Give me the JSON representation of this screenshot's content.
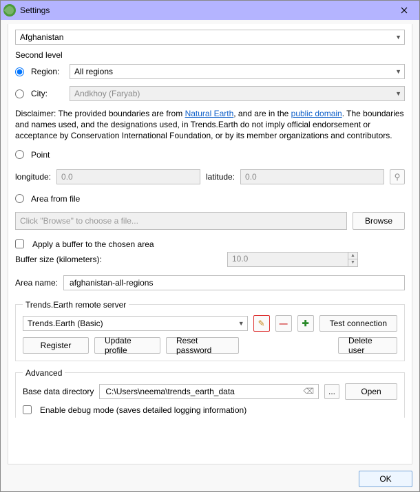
{
  "window": {
    "title": "Settings"
  },
  "country": {
    "value": "Afghanistan"
  },
  "second_level": {
    "heading": "Second level",
    "region_label": "Region:",
    "region_value": "All regions",
    "city_label": "City:",
    "city_value": "Andkhoy (Faryab)"
  },
  "disclaimer": {
    "prefix": "Disclaimer: The provided boundaries are from ",
    "link1": "Natural Earth",
    "mid": ", and are in the ",
    "link2": "public domain",
    "suffix": ". The boundaries and names used, and the designations used, in Trends.Earth do not imply official endorsement or acceptance by Conservation International Foundation, or by its member organizations and contributors."
  },
  "point": {
    "label": "Point",
    "lon_label": "longitude:",
    "lon_value": "0.0",
    "lat_label": "latitude:",
    "lat_value": "0.0"
  },
  "area_file": {
    "label": "Area from file",
    "placeholder": "Click \"Browse\" to choose a file...",
    "browse": "Browse"
  },
  "buffer": {
    "check_label": "Apply a buffer to the chosen area",
    "size_label": "Buffer size (kilometers):",
    "size_value": "10.0"
  },
  "area_name": {
    "label": "Area name:",
    "value": "afghanistan-all-regions"
  },
  "remote": {
    "legend": "Trends.Earth remote server",
    "server_value": "Trends.Earth (Basic)",
    "test": "Test connection",
    "register": "Register",
    "update": "Update profile",
    "reset": "Reset password",
    "delete": "Delete user"
  },
  "advanced": {
    "legend": "Advanced",
    "basedir_label": "Base data directory",
    "basedir_value": "C:\\Users\\neema\\trends_earth_data",
    "open": "Open",
    "browse_ellipsis": "...",
    "debug_label": "Enable debug mode (saves detailed logging information)"
  },
  "footer": {
    "ok": "OK"
  }
}
